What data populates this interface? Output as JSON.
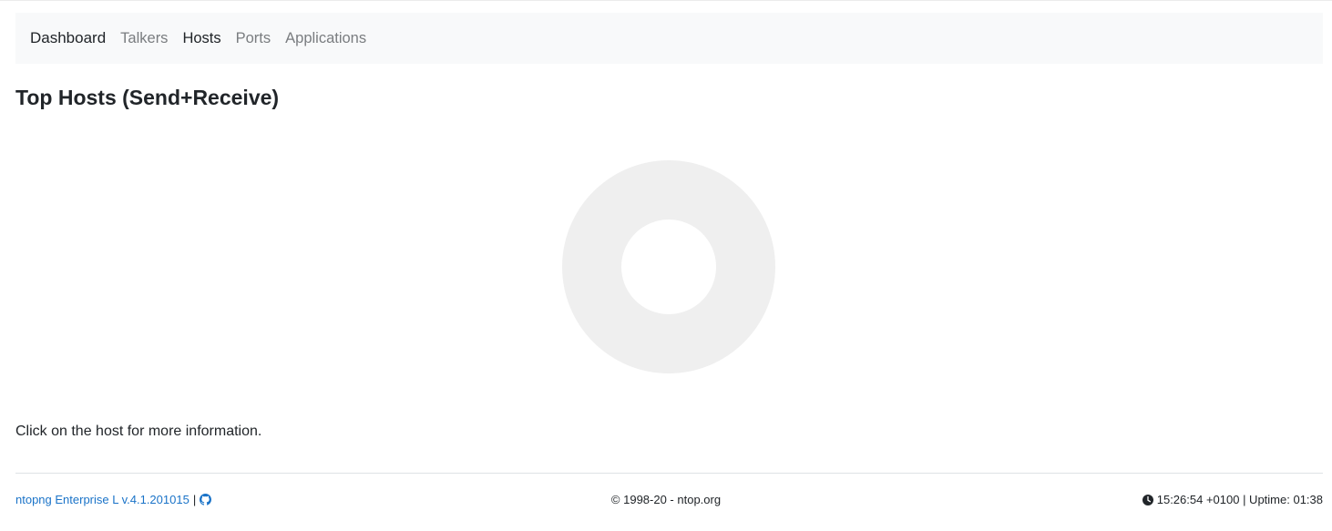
{
  "navbar": {
    "brand": "Dashboard",
    "items": [
      {
        "label": "Talkers",
        "active": false
      },
      {
        "label": "Hosts",
        "active": true
      },
      {
        "label": "Ports",
        "active": false
      },
      {
        "label": "Applications",
        "active": false
      }
    ]
  },
  "main": {
    "title": "Top Hosts (Send+Receive)",
    "info": "Click on the host for more information."
  },
  "chart_data": {
    "type": "pie",
    "title": "",
    "categories": [],
    "values": [],
    "placeholder_color": "#efefef"
  },
  "footer": {
    "version_link": "ntopng Enterprise L v.4.1.201015",
    "separator": "|",
    "github_icon": "github-icon",
    "copyright": "© 1998-20 - ntop.org",
    "clock_icon": "clock-icon",
    "status": "15:26:54 +0100 | Uptime: 01:38"
  },
  "colors": {
    "link": "#1a73c8",
    "navbar_bg": "#f8f9fa",
    "donut_placeholder": "#efefef"
  }
}
